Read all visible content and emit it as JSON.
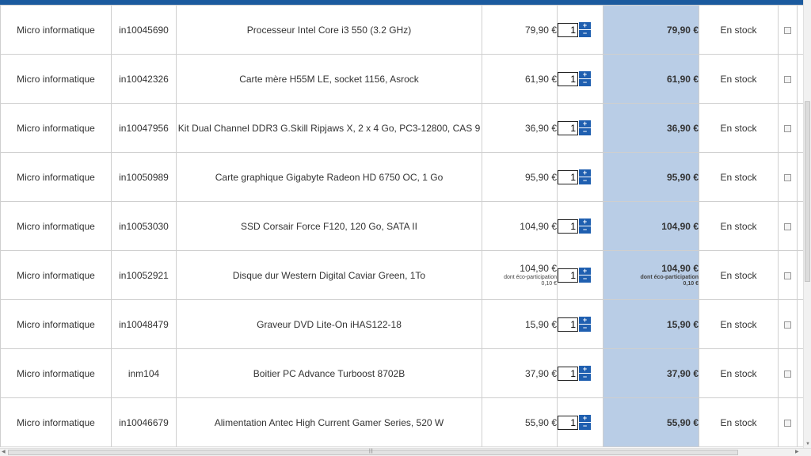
{
  "cart": {
    "rows": [
      {
        "category": "Micro informatique",
        "ref": "in10045690",
        "name": "Processeur Intel Core i3 550 (3.2 GHz)",
        "unit_price": "79,90 €",
        "qty": "1",
        "total": "79,90 €",
        "stock": "En stock",
        "eco_note": "",
        "eco_value": ""
      },
      {
        "category": "Micro informatique",
        "ref": "in10042326",
        "name": "Carte mère H55M LE, socket 1156, Asrock",
        "unit_price": "61,90 €",
        "qty": "1",
        "total": "61,90 €",
        "stock": "En stock",
        "eco_note": "",
        "eco_value": ""
      },
      {
        "category": "Micro informatique",
        "ref": "in10047956",
        "name": "Kit Dual Channel DDR3 G.Skill Ripjaws X, 2 x 4 Go, PC3-12800, CAS 9",
        "unit_price": "36,90 €",
        "qty": "1",
        "total": "36,90 €",
        "stock": "En stock",
        "eco_note": "",
        "eco_value": ""
      },
      {
        "category": "Micro informatique",
        "ref": "in10050989",
        "name": "Carte graphique Gigabyte Radeon HD 6750 OC, 1 Go",
        "unit_price": "95,90 €",
        "qty": "1",
        "total": "95,90 €",
        "stock": "En stock",
        "eco_note": "",
        "eco_value": ""
      },
      {
        "category": "Micro informatique",
        "ref": "in10053030",
        "name": "SSD Corsair Force F120, 120 Go, SATA II",
        "unit_price": "104,90 €",
        "qty": "1",
        "total": "104,90 €",
        "stock": "En stock",
        "eco_note": "",
        "eco_value": ""
      },
      {
        "category": "Micro informatique",
        "ref": "in10052921",
        "name": "Disque dur Western Digital Caviar Green, 1To",
        "unit_price": "104,90 €",
        "qty": "1",
        "total": "104,90 €",
        "stock": "En stock",
        "eco_note": "dont éco-participation",
        "eco_value": "0,10 €"
      },
      {
        "category": "Micro informatique",
        "ref": "in10048479",
        "name": "Graveur DVD Lite-On iHAS122-18",
        "unit_price": "15,90 €",
        "qty": "1",
        "total": "15,90 €",
        "stock": "En stock",
        "eco_note": "",
        "eco_value": ""
      },
      {
        "category": "Micro informatique",
        "ref": "inm104",
        "name": "Boitier PC Advance Turboost 8702B",
        "unit_price": "37,90 €",
        "qty": "1",
        "total": "37,90 €",
        "stock": "En stock",
        "eco_note": "",
        "eco_value": ""
      },
      {
        "category": "Micro informatique",
        "ref": "in10046679",
        "name": "Alimentation Antec High Current Gamer Series, 520 W",
        "unit_price": "55,90 €",
        "qty": "1",
        "total": "55,90 €",
        "stock": "En stock",
        "eco_note": "",
        "eco_value": ""
      }
    ],
    "qty_plus": "+",
    "qty_minus": "−"
  },
  "colors": {
    "header_bar": "#1b5a9e",
    "total_column": "#b9cde6",
    "qty_button": "#1f5fb0"
  },
  "icons": {
    "increase": "plus-icon",
    "decrease": "minus-icon",
    "row_select": "checkbox-icon"
  }
}
